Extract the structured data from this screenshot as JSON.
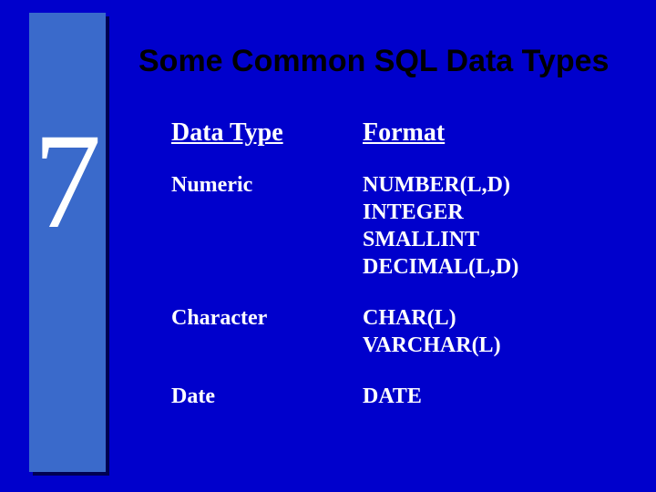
{
  "chapter_number": "7",
  "title": "Some Common SQL Data Types",
  "headers": {
    "type": "Data Type",
    "format": "Format"
  },
  "rows": [
    {
      "type": "Numeric",
      "formats": [
        "NUMBER(L,D)",
        "INTEGER",
        "SMALLINT",
        "DECIMAL(L,D)"
      ]
    },
    {
      "type": "Character",
      "formats": [
        "CHAR(L)",
        "VARCHAR(L)"
      ]
    },
    {
      "type": "Date",
      "formats": [
        "DATE"
      ]
    }
  ]
}
